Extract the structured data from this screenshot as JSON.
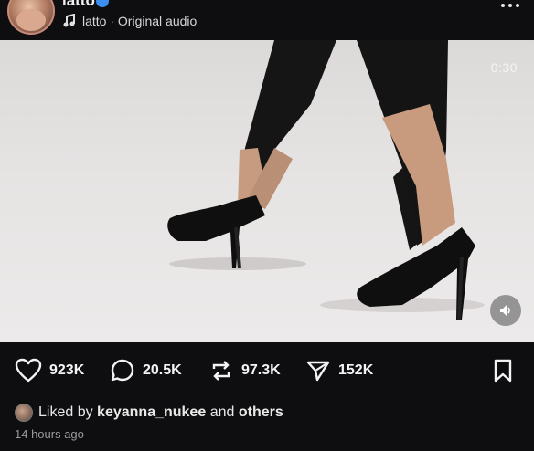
{
  "post": {
    "username": "latto",
    "audio_label": "latto · Original audio",
    "timer": "0:30"
  },
  "icons": {
    "more": "more-options-icon",
    "music": "music-note-icon",
    "sound": "speaker-icon",
    "like": "heart-icon",
    "comment": "comment-bubble-icon",
    "repost": "repost-icon",
    "share": "send-icon",
    "save": "bookmark-icon"
  },
  "actions": {
    "likes": "923K",
    "comments": "20.5K",
    "reposts": "97.3K",
    "shares": "152K"
  },
  "liked_by": {
    "prefix": "Liked by",
    "user": "keyanna_nukee",
    "middle": "and",
    "others": "others"
  },
  "timestamp": "14 hours ago",
  "colors": {
    "background": "#0e0e10",
    "verified": "#3b8ff3",
    "text": "#f3f3f3"
  }
}
